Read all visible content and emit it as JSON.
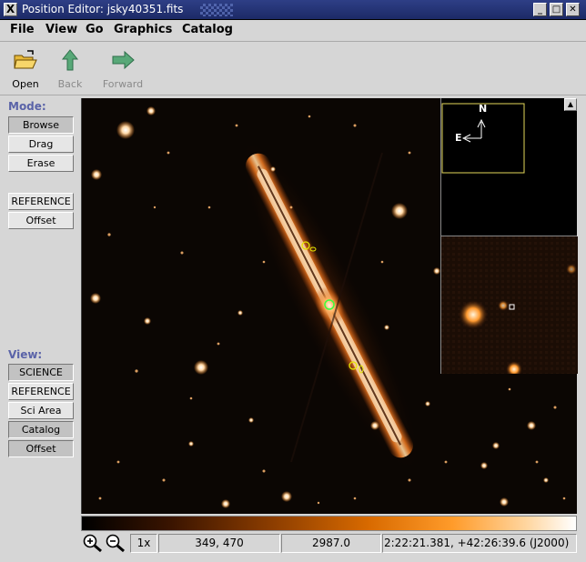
{
  "window": {
    "title": "Position Editor: jsky40351.fits",
    "sys_icon": "X",
    "minimize_label": "_",
    "maximize_label": "□",
    "close_label": "✕"
  },
  "menubar": {
    "items": [
      "File",
      "View",
      "Go",
      "Graphics",
      "Catalog"
    ]
  },
  "toolbar": {
    "open_label": "Open",
    "back_label": "Back",
    "forward_label": "Forward",
    "icons": {
      "open": "folder-open-icon",
      "back": "green-arrow-left-icon",
      "forward": "green-arrow-right-icon"
    }
  },
  "mode_panel": {
    "title": "Mode:",
    "buttons": [
      "Browse",
      "Drag",
      "Erase"
    ],
    "active": "Browse",
    "reference_label": "REFERENCE",
    "offset_label": "Offset"
  },
  "view_panel": {
    "title": "View:",
    "buttons": [
      "SCIENCE",
      "REFERENCE",
      "Sci Area",
      "Catalog",
      "Offset"
    ],
    "active": [
      "SCIENCE",
      "Catalog",
      "Offset"
    ]
  },
  "panner": {
    "north_label": "N",
    "east_label": "E"
  },
  "scroll": {
    "up_arrow": "▲"
  },
  "colors": {
    "title_bg": "#1c2a66",
    "section_label": "#5a63a8",
    "overlay_yellow": "#e5e500",
    "overlay_green": "#3cff3c"
  },
  "status": {
    "zoom_level": "1x",
    "pixel_coords": "349, 470",
    "pixel_value": "2987.0",
    "wcs_coords": "2:22:21.381, +42:26:39.6 (J2000)",
    "icons": {
      "zoom_in": "zoom-in-icon",
      "zoom_out": "zoom-out-icon"
    }
  }
}
